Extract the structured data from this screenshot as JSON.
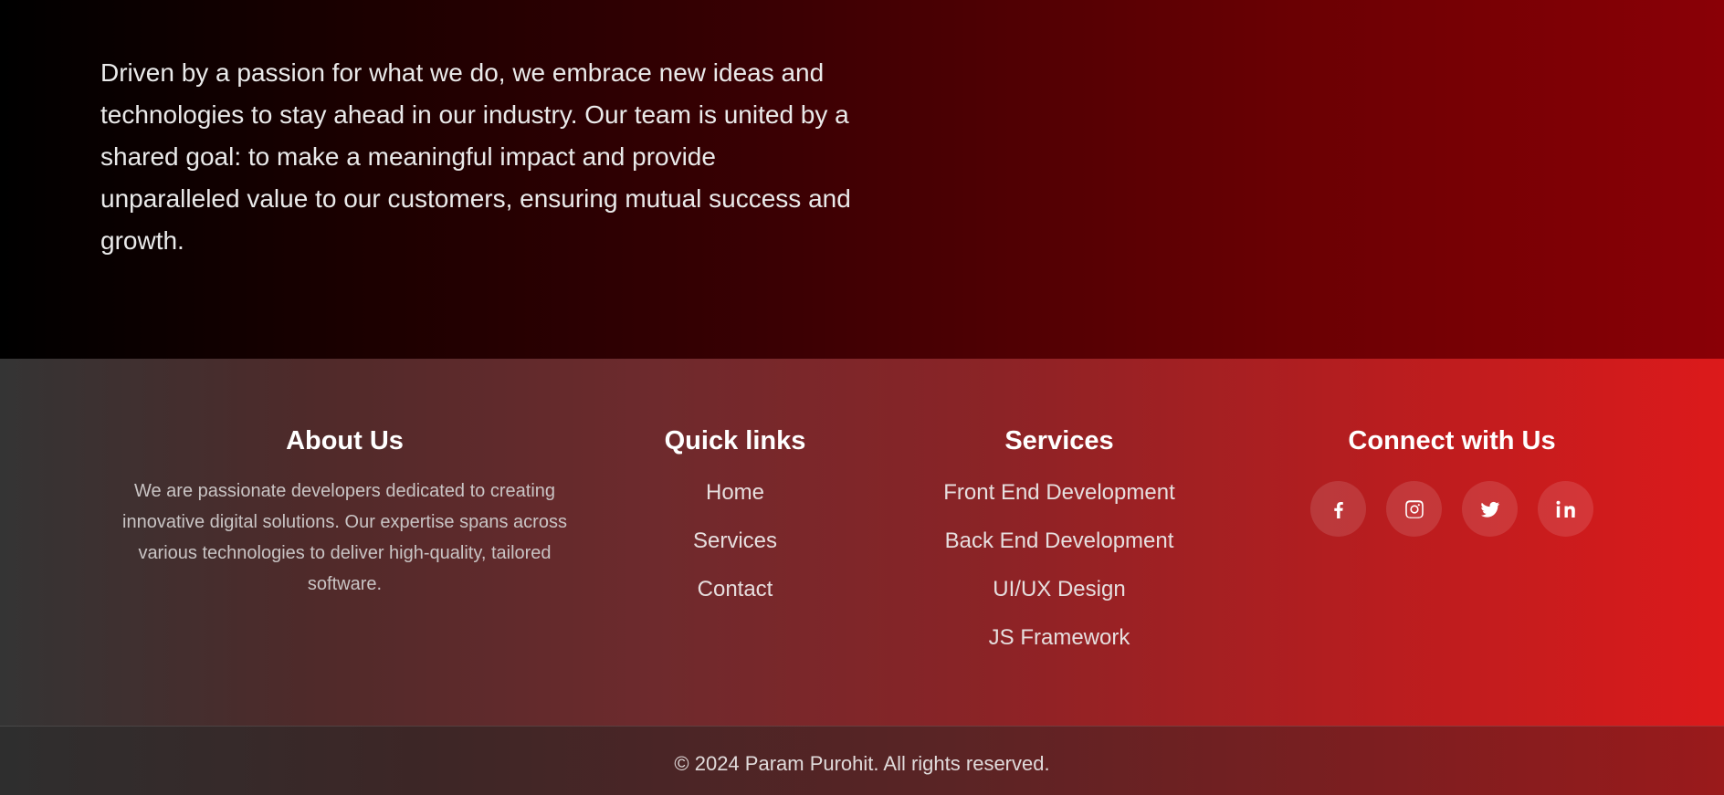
{
  "about_section": {
    "partial_top_text": "",
    "paragraph": "Driven by a passion for what we do, we embrace new ideas and technologies to stay ahead in our industry. Our team is united by a shared goal: to make a meaningful impact and provide unparalleled value to our customers, ensuring mutual success and growth."
  },
  "footer": {
    "about": {
      "title": "About Us",
      "text": "We are passionate developers dedicated to creating innovative digital solutions. Our expertise spans across various technologies to deliver high-quality, tailored software."
    },
    "quick_links": {
      "title": "Quick links",
      "items": [
        "Home",
        "Services",
        "Contact"
      ]
    },
    "services": {
      "title": "Services",
      "items": [
        "Front End Development",
        "Back End Development",
        "UI/UX Design",
        "JS Framework"
      ]
    },
    "connect": {
      "title": "Connect with Us",
      "icons": [
        "facebook-icon",
        "instagram-icon",
        "twitter-icon",
        "linkedin-icon"
      ]
    },
    "copyright": "© 2024 Param Purohit. All rights reserved."
  },
  "colors": {
    "accent_red": "#dc1a1b",
    "dark": "#000000"
  }
}
